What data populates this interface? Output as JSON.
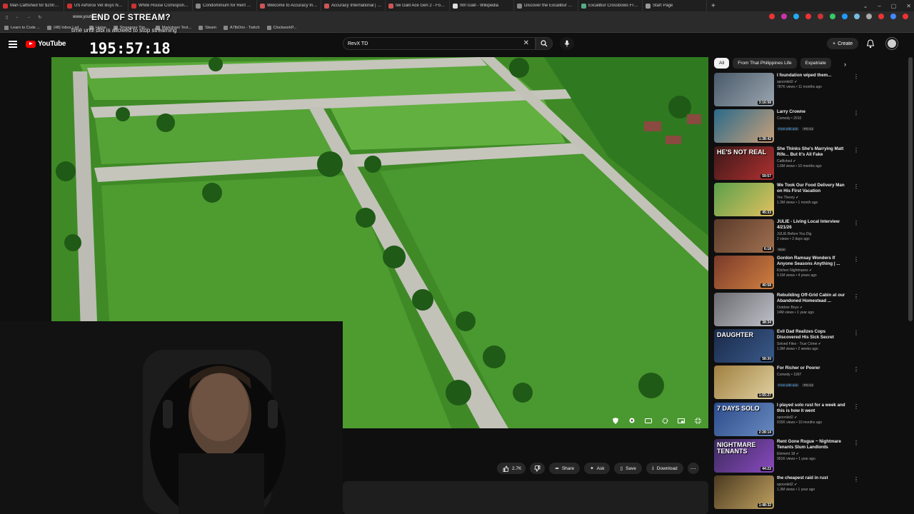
{
  "browser": {
    "tabs": [
      {
        "label": "Man Catfished for $200K, V...",
        "color": "#c33"
      },
      {
        "label": "US Airforce Vet Buys New H...",
        "color": "#c33"
      },
      {
        "label": "White House Corresponden...",
        "color": "#c33"
      },
      {
        "label": "Condominium for Rent at R...",
        "color": "#888"
      },
      {
        "label": "Welcome to Accuracy Inter...",
        "color": "#c55"
      },
      {
        "label": "Accuracy International | Pro...",
        "color": "#c55"
      },
      {
        "label": "Iwi Galil Ace Gen 2 - For Sa...",
        "color": "#c55"
      },
      {
        "label": "IWI Galil - Wikipedia",
        "color": "#ddd"
      },
      {
        "label": "Discover the Excalibur Mag...",
        "color": "#888"
      },
      {
        "label": "Excalibur Crossbows From ...",
        "color": "#5a8"
      },
      {
        "label": "Start Page",
        "color": "#999"
      }
    ],
    "new_tab": "+",
    "url": "www.youtube.com",
    "bookmarks": [
      "Learn to Code ...",
      "(48) Inbox | ad...",
      "Home",
      "Singapore Tim...",
      "Markdown Text...",
      "Steam",
      "A7lbOrix - Twitch",
      "ClockworkP..."
    ],
    "extension_colors": [
      "#e33",
      "#c3a",
      "#2ae",
      "#e33",
      "#c33",
      "#3c6",
      "#29f",
      "#7bd",
      "#aaa",
      "#e33",
      "#48f",
      "#e33"
    ]
  },
  "stream_overlay": {
    "title": "END OF STREAM?",
    "subtitle": "time until dibi is allowed to stop streaming",
    "timer": "195:57:18"
  },
  "youtube": {
    "logo": "YouTube",
    "search_value": "RevX TD",
    "create_label": "Create"
  },
  "video": {
    "likes": "2.7K",
    "share": "Share",
    "ask": "Ask",
    "save": "Save",
    "download": "Download"
  },
  "chips": [
    "All",
    "From That Philippines Life",
    "Expatriate"
  ],
  "recommendations": [
    {
      "title": "I foundation wiped them...",
      "channel": "spoonkid2",
      "verified": true,
      "meta": "787K views • 11 months ago",
      "duration": "3:16:58",
      "thumb": [
        "#4a5a6a",
        "#9aa6b0"
      ],
      "overlay": "",
      "badges": []
    },
    {
      "title": "Larry Crowne",
      "channel": "Comedy • 2010",
      "verified": false,
      "meta": "",
      "duration": "1:38:42",
      "thumb": [
        "#2a6a8a",
        "#c9a07a"
      ],
      "overlay": "",
      "badges": [
        "Free with ads",
        "PG-13"
      ]
    },
    {
      "title": "She Thinks She's Marrying Matt Rife... But It's All Fake",
      "channel": "Catfished",
      "verified": true,
      "meta": "1.6M views • 10 months ago",
      "duration": "59:57",
      "thumb": [
        "#3a1818",
        "#b03030"
      ],
      "overlay": "HE'S NOT REAL",
      "badges": []
    },
    {
      "title": "We Took Our Food Delivery Man on His First Vacation",
      "channel": "Yes Theory",
      "verified": true,
      "meta": "1.3M views • 1 month ago",
      "duration": "45:33",
      "thumb": [
        "#5aa04a",
        "#e0c060"
      ],
      "overlay": "",
      "badges": []
    },
    {
      "title": "JULIE - Living Local Interview 4/21/26",
      "channel": "JULIE Before You Dig",
      "verified": false,
      "meta": "2 views • 2 days ago",
      "duration": "6:18",
      "thumb": [
        "#5a3a2a",
        "#a07050"
      ],
      "overlay": "",
      "badges": [
        "New"
      ]
    },
    {
      "title": "Gordon Ramsay Wonders If Anyone Seasons Anything | ...",
      "channel": "Kitchen Nightmares",
      "verified": true,
      "meta": "9.1M views • 4 years ago",
      "duration": "40:58",
      "thumb": [
        "#7a3a2a",
        "#d08040"
      ],
      "overlay": "",
      "badges": []
    },
    {
      "title": "Rebuilding Off-Grid Cabin at our Abandoned Homestead ...",
      "channel": "Outdoor Boys",
      "verified": true,
      "meta": "14M views • 1 year ago",
      "duration": "38:34",
      "thumb": [
        "#6a6a70",
        "#c0c0c8"
      ],
      "overlay": "",
      "badges": []
    },
    {
      "title": "Evil Dad Realizes Cops Discovered His Sick Secret",
      "channel": "Solved Files - True Crime",
      "verified": true,
      "meta": "1.9M views • 2 weeks ago",
      "duration": "58:30",
      "thumb": [
        "#1a2a4a",
        "#3a5a8a"
      ],
      "overlay": "DAUGHTER",
      "badges": []
    },
    {
      "title": "For Richer or Poorer",
      "channel": "Comedy • 1997",
      "verified": false,
      "meta": "",
      "duration": "1:55:27",
      "thumb": [
        "#a08040",
        "#e0d0a0"
      ],
      "overlay": "",
      "badges": [
        "Free with ads",
        "PG-13"
      ]
    },
    {
      "title": "I played solo rust for a week and this is how it went",
      "channel": "spoonkid2",
      "verified": true,
      "meta": "915K views • 10 months ago",
      "duration": "2:28:14",
      "thumb": [
        "#2a4a8a",
        "#6a8ac0"
      ],
      "overlay": "7 DAYS SOLO",
      "badges": []
    },
    {
      "title": "Rent Gone Rogue ~ Nightmare Tenants Slum Landlords",
      "channel": "Element 18",
      "verified": true,
      "meta": "951K views • 1 year ago",
      "duration": "44:22",
      "thumb": [
        "#3a2a5a",
        "#8a4ac0"
      ],
      "overlay": "NIGHTMARE TENANTS",
      "badges": []
    },
    {
      "title": "the cheapest raid in rust",
      "channel": "spoonkid2",
      "verified": true,
      "meta": "1.3M views • 1 year ago",
      "duration": "1:48:32",
      "thumb": [
        "#4a3a20",
        "#c0a060"
      ],
      "overlay": "",
      "badges": []
    }
  ]
}
